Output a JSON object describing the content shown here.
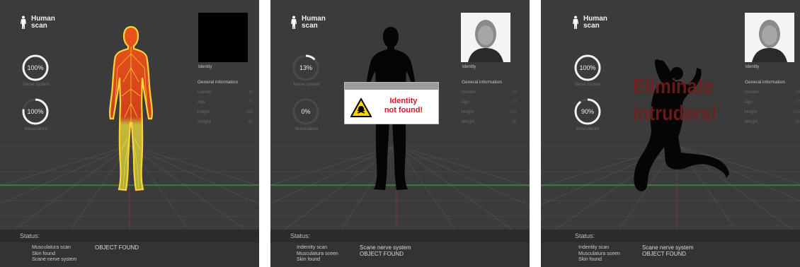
{
  "app": {
    "logo_line1": "Human",
    "logo_line2": "scan"
  },
  "labels": {
    "nerve_system": "Nerve system",
    "musculature": "Musculature",
    "identity": "Identity",
    "general_information": "General information",
    "gender": "Gender",
    "age": "Age",
    "height": "Height",
    "weight": "Weight",
    "status": "Status:"
  },
  "panels": [
    {
      "nerve_percent": "100%",
      "nerve_fraction": 1.0,
      "muscle_percent": "100%",
      "muscle_fraction": 0.78,
      "info_values": [
        "M",
        "27",
        "185",
        "80"
      ],
      "status_log": [
        "Musculatura scan",
        "Skin found",
        "Scane nerve system"
      ],
      "status_result": [
        "OBJECT FOUND"
      ]
    },
    {
      "nerve_percent": "13%",
      "nerve_fraction": 0.13,
      "muscle_percent": "0%",
      "muscle_fraction": 0.0,
      "info_values": [
        "M",
        "27",
        "185",
        "80"
      ],
      "warning_line1": "Identity",
      "warning_line2": "not found!",
      "status_log": [
        "Indentity scan",
        "Musculatura sceen",
        "Skin found"
      ],
      "status_result": [
        "Scane nerve system",
        "OBJECT FOUND"
      ]
    },
    {
      "nerve_percent": "100%",
      "nerve_fraction": 1.0,
      "muscle_percent": "90%",
      "muscle_fraction": 0.9,
      "info_values": [
        "M",
        "27",
        "185",
        "80"
      ],
      "overlay_line1": "Eliminate",
      "overlay_line2": "intruders!",
      "status_log": [
        "Indentity scan",
        "Musculatura sceen",
        "Skin found"
      ],
      "status_result": [
        "Scane nerve system",
        "OBJECT FOUND"
      ]
    }
  ],
  "colors": {
    "background": "#3b3b3b",
    "grid": "#555555",
    "horizon": "#2fae2f",
    "axis": "#b02020",
    "gauge_track": "#4a4a4a",
    "gauge_fill": "#f2f2f2",
    "nerve_yellow": "#ffd23a",
    "nerve_orange": "#e3621a",
    "warning_red": "#d1152c"
  }
}
